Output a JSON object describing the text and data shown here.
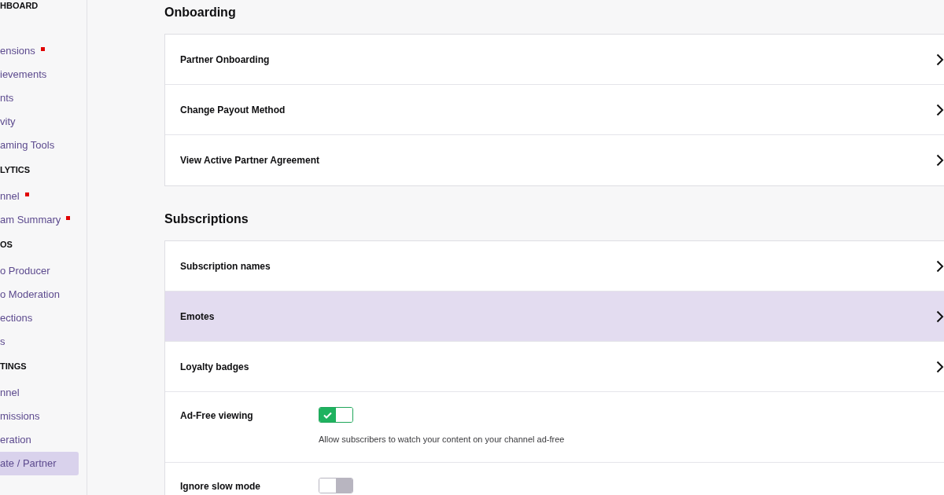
{
  "sidebar": {
    "sections": [
      {
        "header": "HBOARD",
        "items": [
          {
            "label": "ensions",
            "badge": true,
            "selected": false
          },
          {
            "label": "ievements",
            "badge": false,
            "selected": false
          },
          {
            "label": "nts",
            "badge": false,
            "selected": false
          },
          {
            "label": "vity",
            "badge": false,
            "selected": false
          },
          {
            "label": "aming Tools",
            "badge": false,
            "selected": false
          }
        ]
      },
      {
        "header": "LYTICS",
        "items": [
          {
            "label": "nnel",
            "badge": true,
            "selected": false
          },
          {
            "label": "am Summary",
            "badge": true,
            "selected": false
          }
        ]
      },
      {
        "header": "OS",
        "items": [
          {
            "label": "o Producer",
            "badge": false,
            "selected": false
          },
          {
            "label": "o Moderation",
            "badge": false,
            "selected": false
          },
          {
            "label": "ections",
            "badge": false,
            "selected": false
          },
          {
            "label": "s",
            "badge": false,
            "selected": false
          }
        ]
      },
      {
        "header": "TINGS",
        "items": [
          {
            "label": "nnel",
            "badge": false,
            "selected": false
          },
          {
            "label": "missions",
            "badge": false,
            "selected": false
          },
          {
            "label": "eration",
            "badge": false,
            "selected": false
          },
          {
            "label": "ate / Partner",
            "badge": false,
            "selected": true
          }
        ]
      }
    ]
  },
  "sections": [
    {
      "title": "Onboarding",
      "rows": [
        {
          "kind": "link",
          "label": "Partner Onboarding",
          "selected": false
        },
        {
          "kind": "link",
          "label": "Change Payout Method",
          "selected": false
        },
        {
          "kind": "link",
          "label": "View Active Partner Agreement",
          "selected": false
        }
      ]
    },
    {
      "title": "Subscriptions",
      "rows": [
        {
          "kind": "link",
          "label": "Subscription names",
          "selected": false
        },
        {
          "kind": "link",
          "label": "Emotes",
          "selected": true
        },
        {
          "kind": "link",
          "label": "Loyalty badges",
          "selected": false
        },
        {
          "kind": "toggle",
          "label": "Ad-Free viewing",
          "on": true,
          "description": "Allow subscribers to watch your content on your channel ad-free"
        },
        {
          "kind": "toggle",
          "label": "Ignore slow mode",
          "on": false
        }
      ]
    }
  ]
}
